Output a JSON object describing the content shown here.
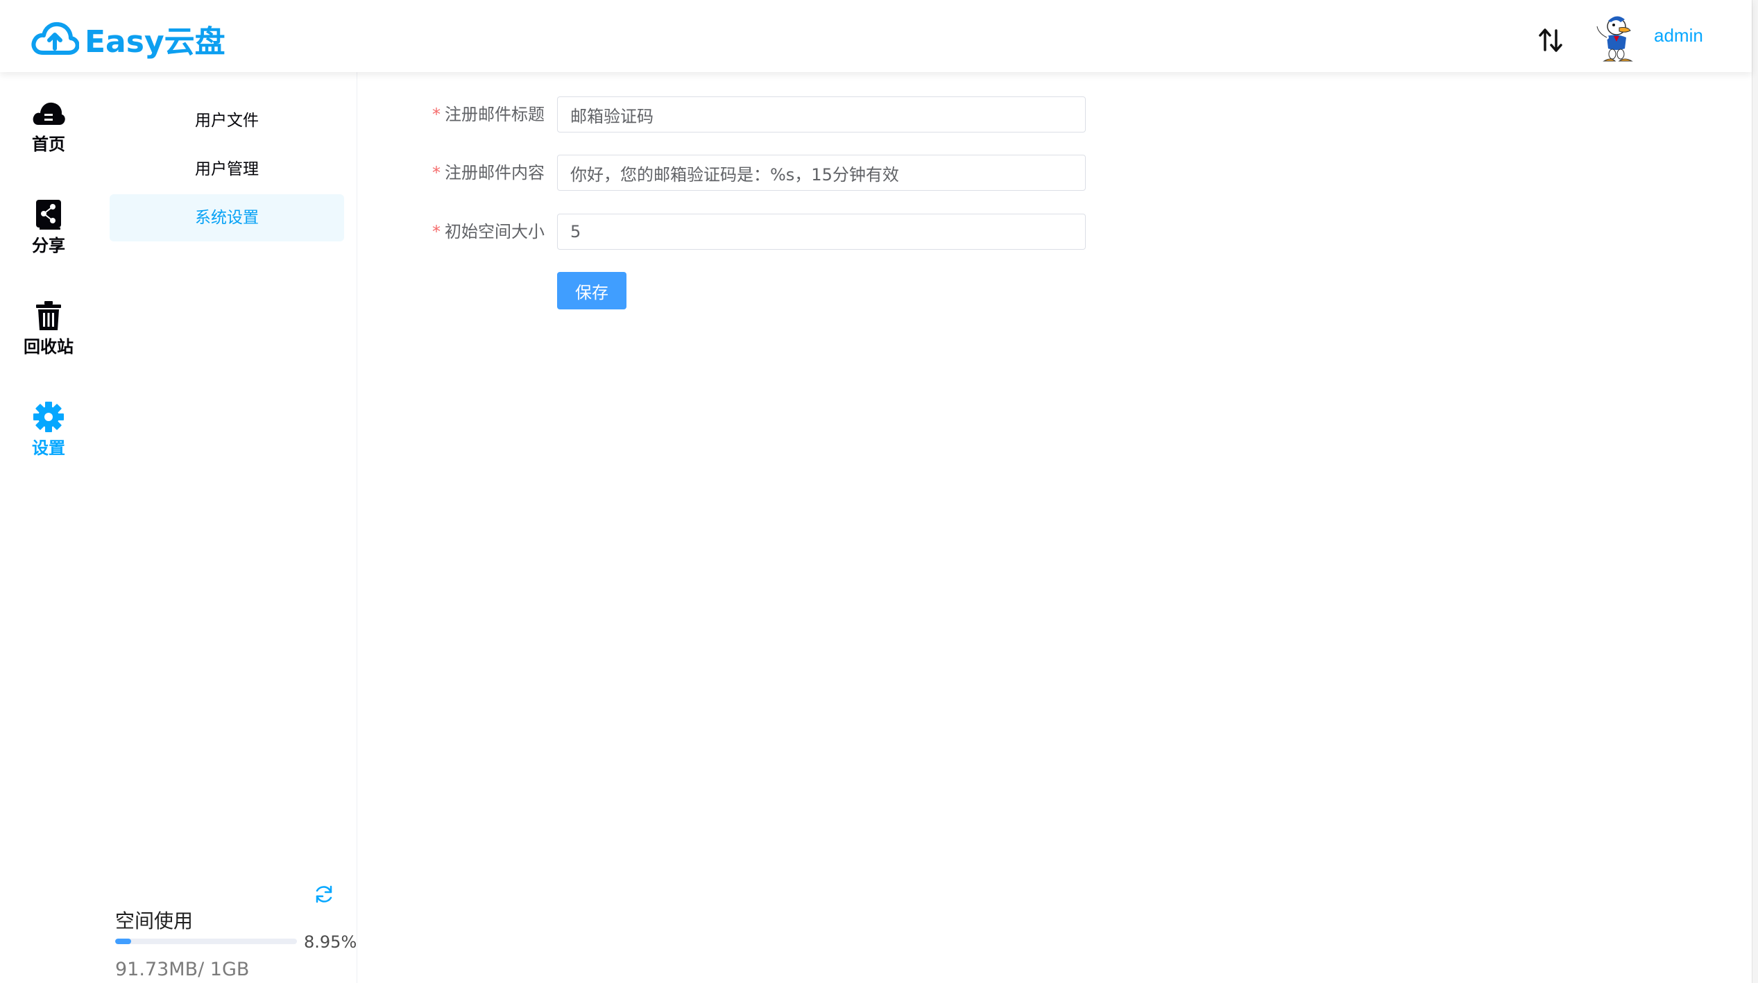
{
  "app": {
    "name": "Easy云盘",
    "brand_color": "#0d9ff0",
    "accent_color": "#409eff"
  },
  "header": {
    "username": "admin",
    "transfer_icon": "sort-arrows-icon",
    "avatar_icon": "duck-avatar"
  },
  "menu": {
    "items": [
      {
        "label": "首页",
        "icon": "cloud-icon"
      },
      {
        "label": "分享",
        "icon": "share-icon"
      },
      {
        "label": "回收站",
        "icon": "trash-icon"
      },
      {
        "label": "设置",
        "icon": "gear-icon",
        "active": true
      }
    ]
  },
  "submenu": {
    "items": [
      {
        "label": "用户文件"
      },
      {
        "label": "用户管理"
      },
      {
        "label": "系统设置",
        "active": true
      }
    ]
  },
  "space": {
    "title": "空间使用",
    "percent_text": "8.95%",
    "percent": 8.95,
    "used_text": "91.73MB/ 1GB"
  },
  "form": {
    "required_mark": "*",
    "fields": [
      {
        "label": "注册邮件标题",
        "value": "邮箱验证码"
      },
      {
        "label": "注册邮件内容",
        "value": "你好，您的邮箱验证码是：%s，15分钟有效"
      },
      {
        "label": "初始空间大小",
        "value": "5"
      }
    ],
    "save_label": "保存"
  }
}
